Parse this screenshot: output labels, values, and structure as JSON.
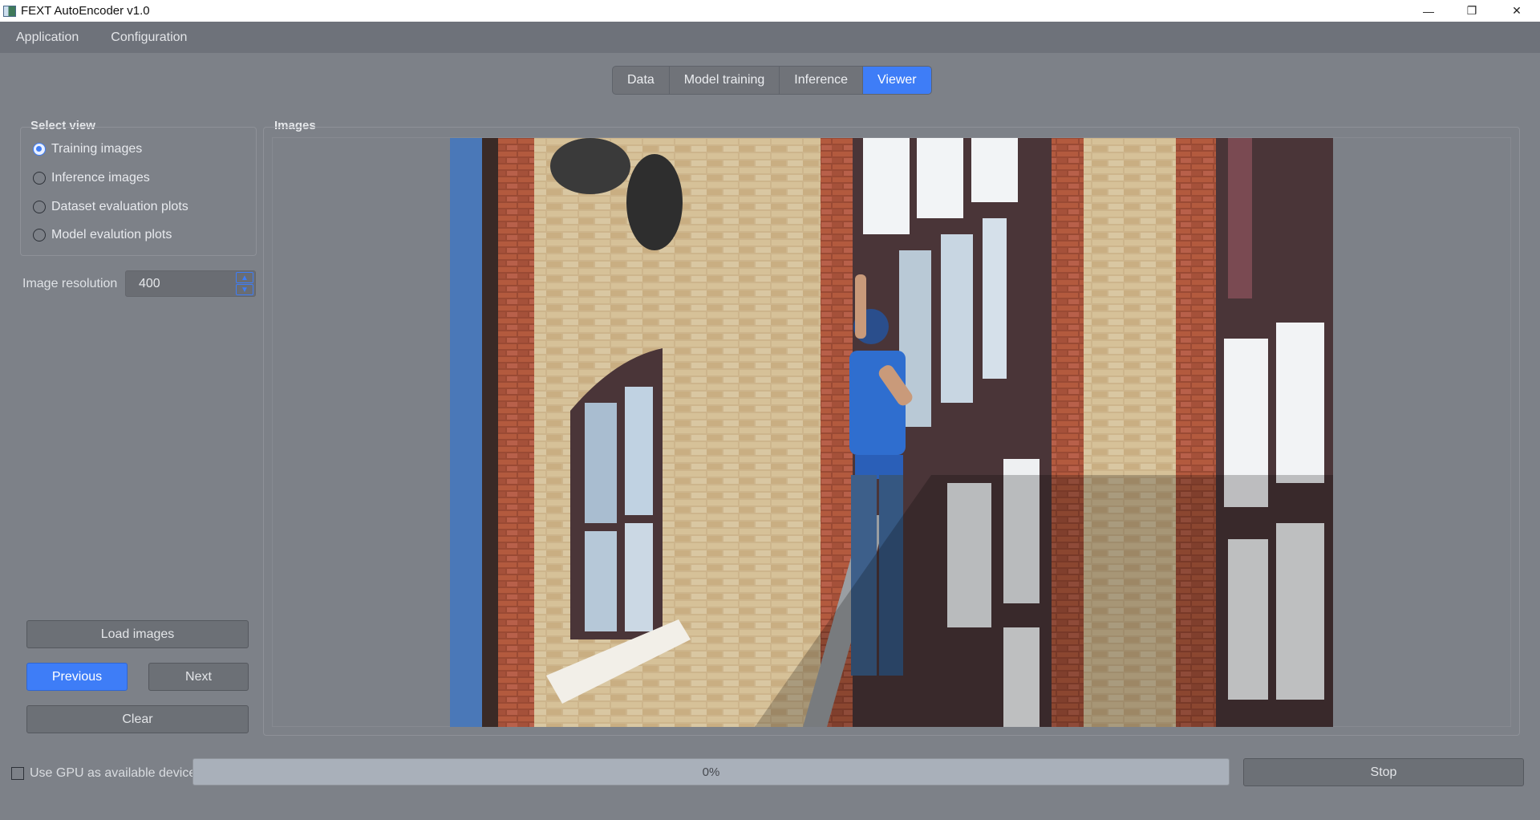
{
  "window": {
    "title": "FEXT AutoEncoder v1.0"
  },
  "menubar": {
    "items": [
      "Application",
      "Configuration"
    ]
  },
  "tabs": [
    {
      "label": "Data",
      "active": false
    },
    {
      "label": "Model training",
      "active": false
    },
    {
      "label": "Inference",
      "active": false
    },
    {
      "label": "Viewer",
      "active": true
    }
  ],
  "select_view": {
    "title": "Select view",
    "options": [
      {
        "label": "Training images",
        "checked": true
      },
      {
        "label": "Inference images",
        "checked": false
      },
      {
        "label": "Dataset evaluation plots",
        "checked": false
      },
      {
        "label": "Model evalution plots",
        "checked": false
      }
    ]
  },
  "image_resolution": {
    "label": "Image resolution",
    "value": "400"
  },
  "buttons": {
    "load": "Load images",
    "previous": "Previous",
    "next": "Next",
    "clear": "Clear",
    "stop": "Stop"
  },
  "images_panel": {
    "title": "Images"
  },
  "footer": {
    "gpu_label": "Use GPU as available device",
    "gpu_checked": false,
    "progress_text": "0%",
    "progress_value": 0
  },
  "colors": {
    "accent": "#3e7df7",
    "background": "#7d8188"
  }
}
